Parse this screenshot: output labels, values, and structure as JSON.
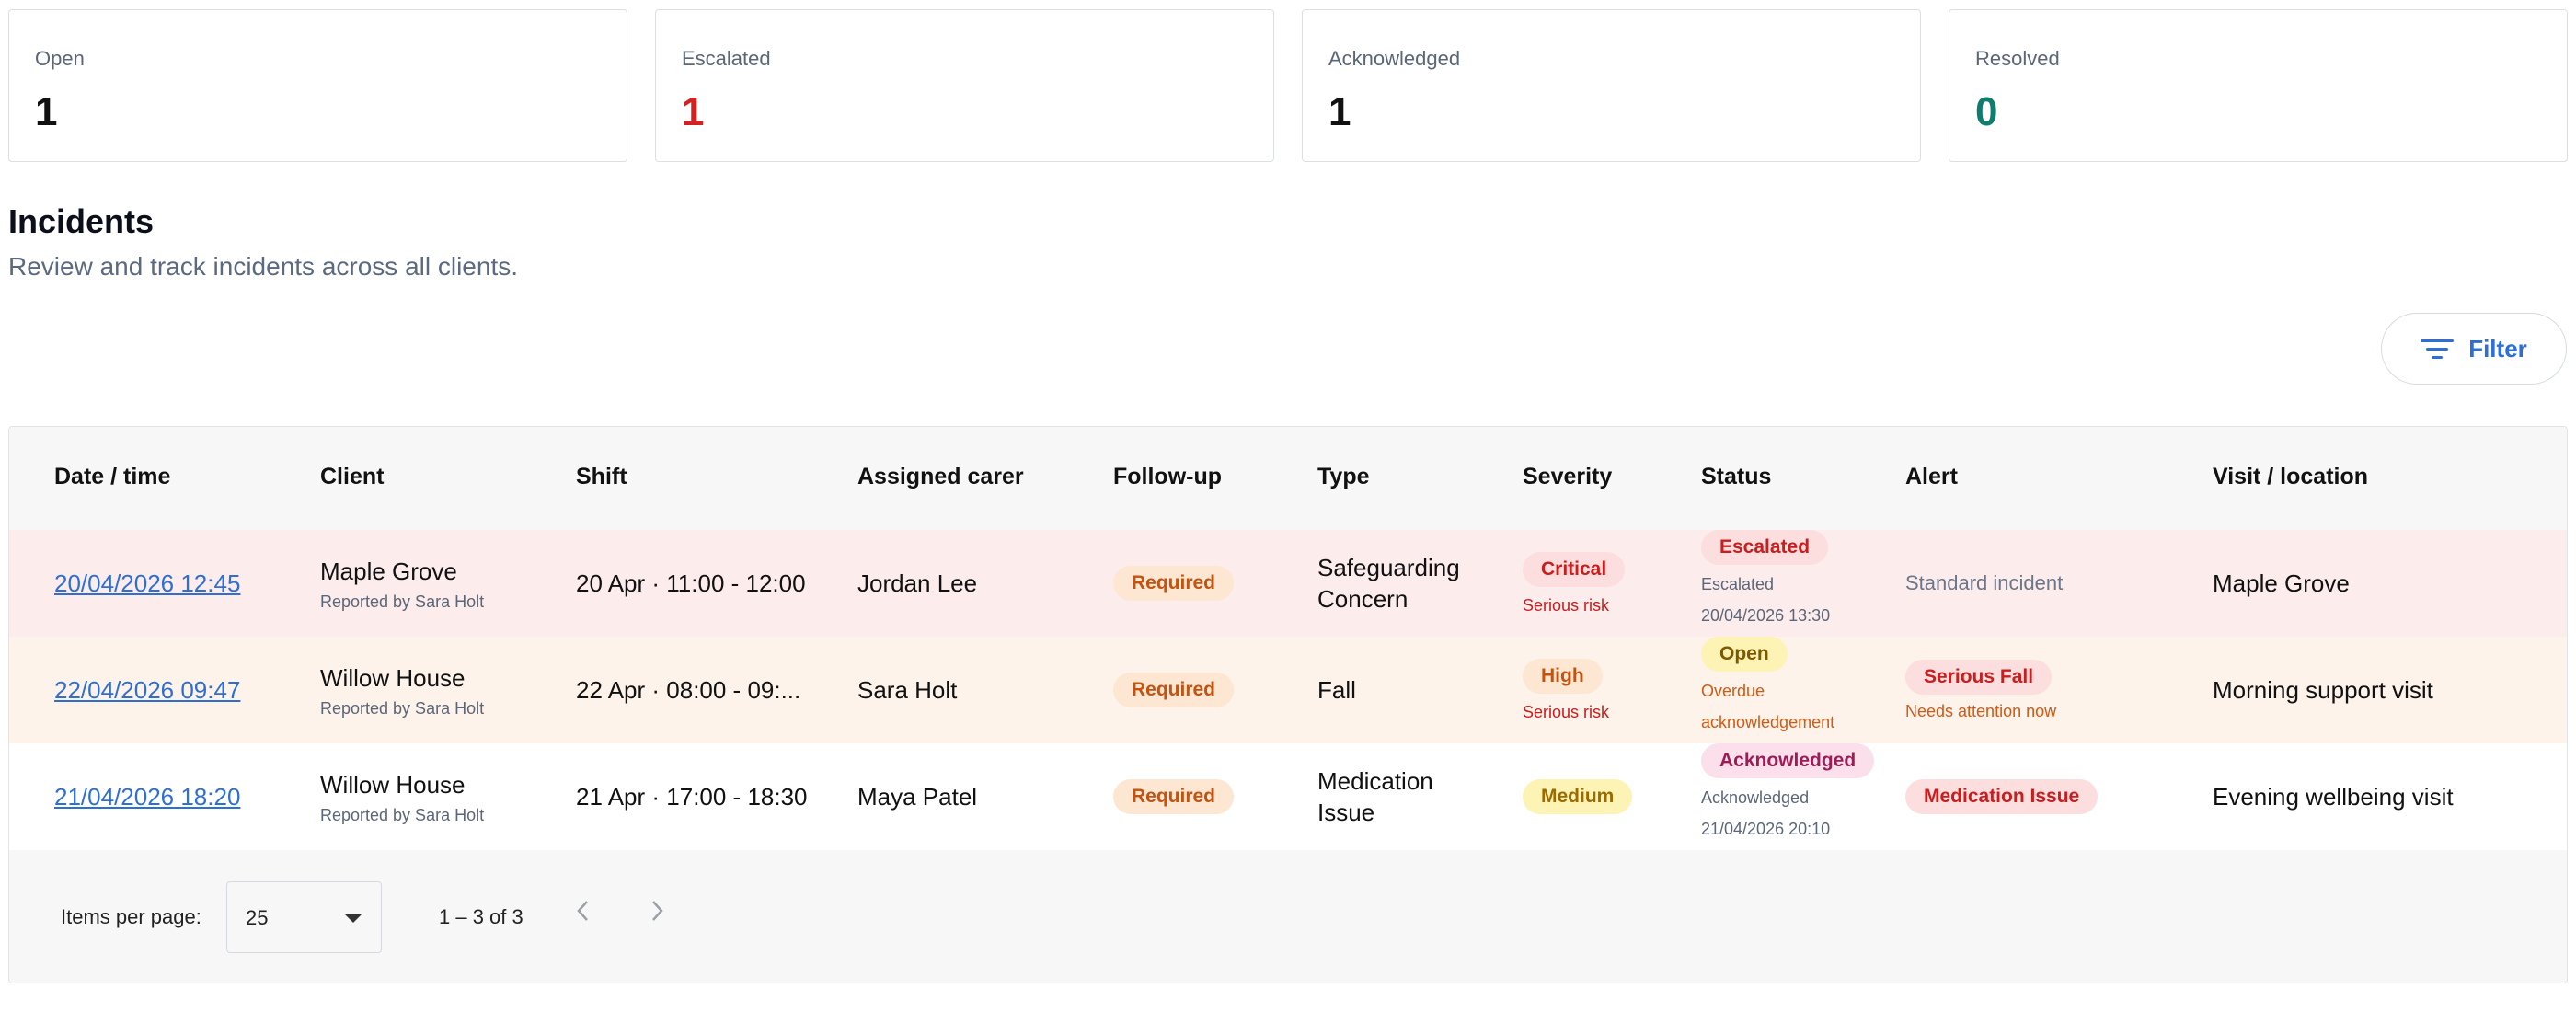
{
  "summary": [
    {
      "label": "Open",
      "value": "1",
      "color": "#111111"
    },
    {
      "label": "Escalated",
      "value": "1",
      "color": "#d32222"
    },
    {
      "label": "Acknowledged",
      "value": "1",
      "color": "#111111"
    },
    {
      "label": "Resolved",
      "value": "0",
      "color": "#0f7d6e"
    }
  ],
  "header": {
    "title": "Incidents",
    "subtitle": "Review and track incidents across all clients."
  },
  "toolbar": {
    "filter_label": "Filter",
    "filter_icon": "filter-lines-icon"
  },
  "table": {
    "columns": [
      "Date / time",
      "Client",
      "Shift",
      "Assigned carer",
      "Follow-up",
      "Type",
      "Severity",
      "Status",
      "Alert",
      "Visit / location"
    ],
    "rows": [
      {
        "datetime": "20/04/2026 12:45",
        "client": "Maple Grove",
        "reported_by": "Reported by Sara Holt",
        "shift": "20 Apr · 11:00 - 12:00",
        "carer": "Jordan Lee",
        "followup": "Required",
        "type_line1": "Safeguarding",
        "type_line2": "Concern",
        "severity": "Critical",
        "severity_note": "Serious risk",
        "status": "Escalated",
        "status_note_1": "Escalated",
        "status_note_2": "20/04/2026 13:30",
        "alert": "Standard incident",
        "location": "Maple Grove"
      },
      {
        "datetime": "22/04/2026 09:47",
        "client": "Willow House",
        "reported_by": "Reported by Sara Holt",
        "shift": "22 Apr · 08:00 - 09:...",
        "carer": "Sara Holt",
        "followup": "Required",
        "type_line1": "Fall",
        "severity": "High",
        "severity_note": "Serious risk",
        "status": "Open",
        "status_note_1": "Overdue",
        "status_note_2": "acknowledgement",
        "alert": "Serious Fall",
        "alert_note": "Needs attention now",
        "location": "Morning support visit"
      },
      {
        "datetime": "21/04/2026 18:20",
        "client": "Willow House",
        "reported_by": "Reported by Sara Holt",
        "shift": "21 Apr · 17:00 - 18:30",
        "carer": "Maya Patel",
        "followup": "Required",
        "type_line1": "Medication",
        "type_line2": "Issue",
        "severity": "Medium",
        "status": "Acknowledged",
        "status_note_1": "Acknowledged",
        "status_note_2": "21/04/2026 20:10",
        "alert": "Medication Issue",
        "location": "Evening wellbeing visit"
      }
    ]
  },
  "pagination": {
    "items_per_page_label": "Items per page:",
    "page_size": "25",
    "range_label": "1 – 3 of 3"
  }
}
